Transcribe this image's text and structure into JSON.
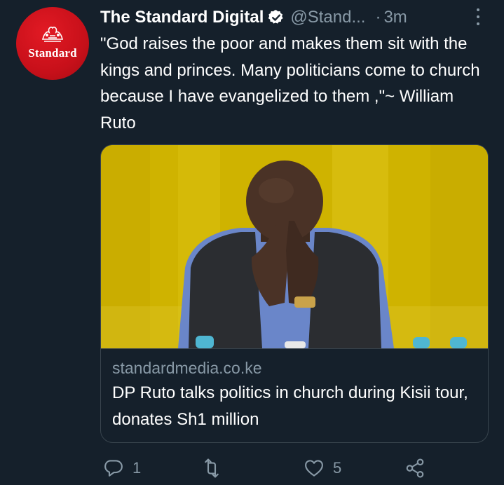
{
  "account": {
    "avatar_text": "Standard",
    "display_name": "The Standard Digital",
    "handle": "@Stand...",
    "separator": "·",
    "time": "3m"
  },
  "tweet": {
    "text": "\"God raises the poor and makes them sit with the kings and princes. Many politicians come to church because I have evangelized to them ,\"~ William Ruto"
  },
  "card": {
    "domain": "standardmedia.co.ke",
    "title": "DP Ruto talks politics in church during Kisii tour, donates Sh1 million"
  },
  "actions": {
    "reply_count": "1",
    "retweet_count": "",
    "like_count": "5"
  },
  "icons": {
    "verified": "verified-badge-icon",
    "more": "more-icon",
    "reply": "reply-icon",
    "retweet": "retweet-icon",
    "like": "heart-icon",
    "share": "share-icon"
  },
  "colors": {
    "background": "#15202b",
    "secondary_text": "#8899a6",
    "border": "#38444d",
    "avatar_red": "#d0121c"
  }
}
